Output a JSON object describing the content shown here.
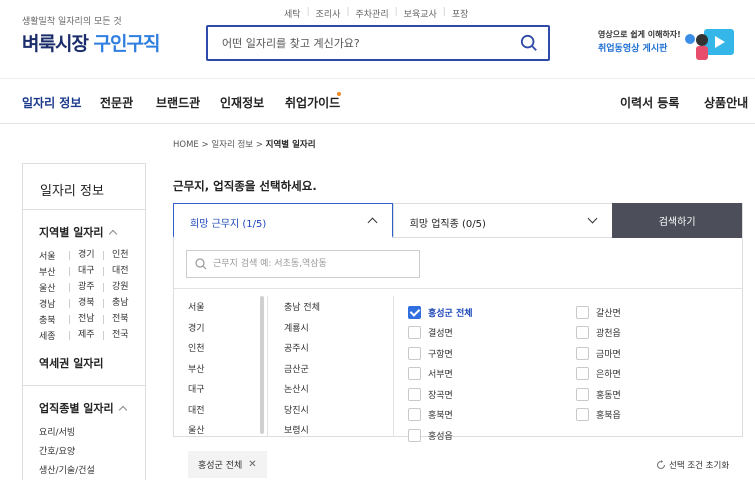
{
  "header": {
    "top_links": [
      "세탁",
      "조리사",
      "주차관리",
      "보육교사",
      "포장"
    ],
    "logo_sub": "생활밀착 일자리의 모든 것",
    "logo_main": "벼룩시장",
    "logo_accent": "구인구직",
    "search_placeholder": "어떤 일자리를 찾고 계신가요?",
    "banner_line1": "영상으로 쉽게 이해하자!",
    "banner_line2": "취업동영상 게시판"
  },
  "nav": {
    "items": [
      "일자리 정보",
      "전문관",
      "브랜드관",
      "인재정보",
      "취업가이드"
    ],
    "right_items": [
      "이력서 등록",
      "상품안내"
    ]
  },
  "breadcrumb": {
    "home": "HOME",
    "mid": "일자리 정보",
    "current": "지역별 일자리"
  },
  "sidebar": {
    "title": "일자리 정보",
    "region_title": "지역별 일자리",
    "regions": [
      [
        "서울",
        "경기",
        "인천"
      ],
      [
        "부산",
        "대구",
        "대전"
      ],
      [
        "울산",
        "광주",
        "강원"
      ],
      [
        "경남",
        "경북",
        "충남"
      ],
      [
        "충북",
        "전남",
        "전북"
      ],
      [
        "세종",
        "제주",
        "전국"
      ]
    ],
    "station_link": "역세권 일자리",
    "job_title": "업직종별 일자리",
    "jobs": [
      "요리/서빙",
      "간호/요양",
      "생산/기술/건설"
    ]
  },
  "main": {
    "title": "근무지, 업직종을 선택하세요.",
    "tab_location": "희망 근무지 (1/5)",
    "tab_job": "희망 업직종 (0/5)",
    "search_button": "검색하기",
    "area_placeholder": "근무지 검색 예: 서초동,역삼동",
    "provinces": [
      "서울",
      "경기",
      "인천",
      "부산",
      "대구",
      "대전",
      "울산"
    ],
    "cities": [
      "충남 전체",
      "계룡시",
      "공주시",
      "금산군",
      "논산시",
      "당진시",
      "보령시"
    ],
    "towns_left": [
      {
        "label": "홍성군 전체",
        "checked": true
      },
      {
        "label": "결성면",
        "checked": false
      },
      {
        "label": "구항면",
        "checked": false
      },
      {
        "label": "서부면",
        "checked": false
      },
      {
        "label": "장곡면",
        "checked": false
      },
      {
        "label": "홍북면",
        "checked": false
      },
      {
        "label": "홍성읍",
        "checked": false
      }
    ],
    "towns_right": [
      {
        "label": "갈산면",
        "checked": false
      },
      {
        "label": "광천읍",
        "checked": false
      },
      {
        "label": "금마면",
        "checked": false
      },
      {
        "label": "은하면",
        "checked": false
      },
      {
        "label": "홍동면",
        "checked": false
      },
      {
        "label": "홍북읍",
        "checked": false
      }
    ],
    "chip": "홍성군 전체",
    "reset": "선택 조건 초기화"
  },
  "colors": {
    "brand_navy": "#1b2d6b",
    "brand_blue": "#2f7fe0",
    "accent_orange": "#f08a24",
    "button_dark": "#4c4f5a"
  }
}
